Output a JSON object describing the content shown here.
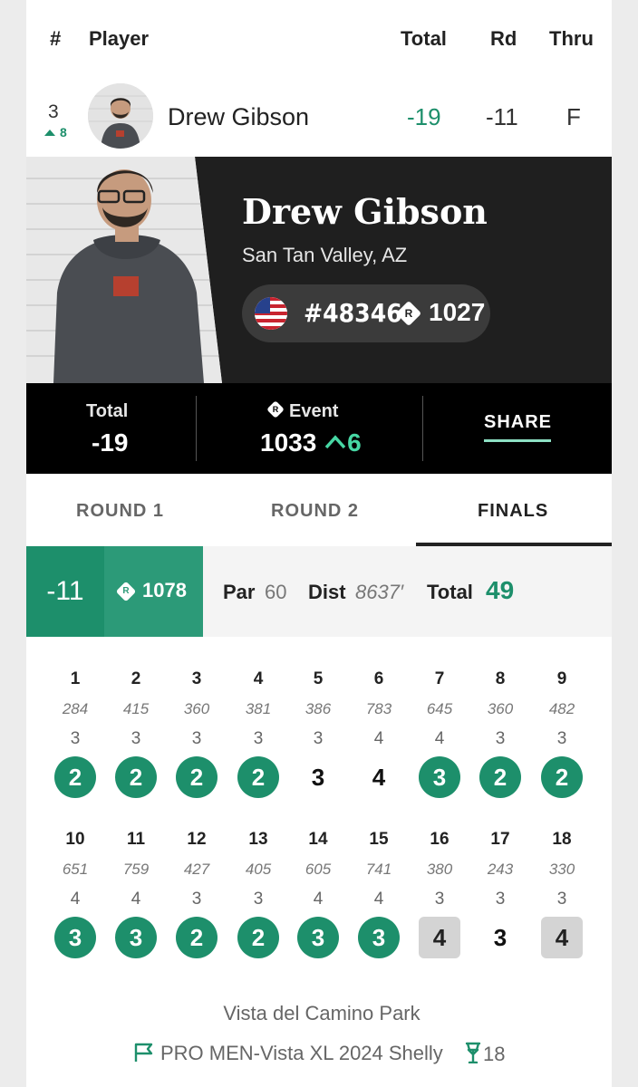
{
  "header": {
    "rank_col": "#",
    "player_col": "Player",
    "total_col": "Total",
    "round_col": "Rd",
    "thru_col": "Thru"
  },
  "player_row": {
    "position": "3",
    "movement": "8",
    "name": "Drew Gibson",
    "total": "-19",
    "round": "-11",
    "thru": "F"
  },
  "card": {
    "name": "Drew Gibson",
    "location": "San Tan Valley, AZ",
    "pdga_number": "#48346",
    "rating": "1027",
    "rating_icon_letter": "R"
  },
  "stats": {
    "total_label": "Total",
    "total_value": "-19",
    "event_label": "Event",
    "event_rating": "1033",
    "event_change": "6",
    "share_label": "SHARE"
  },
  "tabs": [
    {
      "label": "ROUND 1",
      "active": false
    },
    {
      "label": "ROUND 2",
      "active": false
    },
    {
      "label": "FINALS",
      "active": true
    }
  ],
  "round_summary": {
    "score": "-11",
    "round_rating": "1078",
    "par_label": "Par",
    "par_value": "60",
    "dist_label": "Dist",
    "dist_value": "8637′",
    "total_label": "Total",
    "total_value": "49"
  },
  "holes": [
    {
      "num": "1",
      "dist": "284",
      "par": "3",
      "score": "2",
      "result": "birdie"
    },
    {
      "num": "2",
      "dist": "415",
      "par": "3",
      "score": "2",
      "result": "birdie"
    },
    {
      "num": "3",
      "dist": "360",
      "par": "3",
      "score": "2",
      "result": "birdie"
    },
    {
      "num": "4",
      "dist": "381",
      "par": "3",
      "score": "2",
      "result": "birdie"
    },
    {
      "num": "5",
      "dist": "386",
      "par": "3",
      "score": "3",
      "result": "par"
    },
    {
      "num": "6",
      "dist": "783",
      "par": "4",
      "score": "4",
      "result": "par"
    },
    {
      "num": "7",
      "dist": "645",
      "par": "4",
      "score": "3",
      "result": "birdie"
    },
    {
      "num": "8",
      "dist": "360",
      "par": "3",
      "score": "2",
      "result": "birdie"
    },
    {
      "num": "9",
      "dist": "482",
      "par": "3",
      "score": "2",
      "result": "birdie"
    },
    {
      "num": "10",
      "dist": "651",
      "par": "4",
      "score": "3",
      "result": "birdie"
    },
    {
      "num": "11",
      "dist": "759",
      "par": "4",
      "score": "3",
      "result": "birdie"
    },
    {
      "num": "12",
      "dist": "427",
      "par": "3",
      "score": "2",
      "result": "birdie"
    },
    {
      "num": "13",
      "dist": "405",
      "par": "3",
      "score": "2",
      "result": "birdie"
    },
    {
      "num": "14",
      "dist": "605",
      "par": "4",
      "score": "3",
      "result": "birdie"
    },
    {
      "num": "15",
      "dist": "741",
      "par": "4",
      "score": "3",
      "result": "birdie"
    },
    {
      "num": "16",
      "dist": "380",
      "par": "3",
      "score": "4",
      "result": "bogey"
    },
    {
      "num": "17",
      "dist": "243",
      "par": "3",
      "score": "3",
      "result": "par"
    },
    {
      "num": "18",
      "dist": "330",
      "par": "3",
      "score": "4",
      "result": "bogey"
    }
  ],
  "footer": {
    "course": "Vista del Camino Park",
    "division_layout": "PRO MEN-Vista XL 2024 Shelly",
    "hole_count": "18"
  },
  "colors": {
    "accent_green": "#1d8f6b",
    "bogey_gray": "#d4d4d4",
    "card_dark": "#1f1f1f"
  },
  "icons": [
    "up-arrow-icon",
    "us-flag-icon",
    "rating-diamond-icon",
    "flag-icon",
    "basket-icon"
  ]
}
